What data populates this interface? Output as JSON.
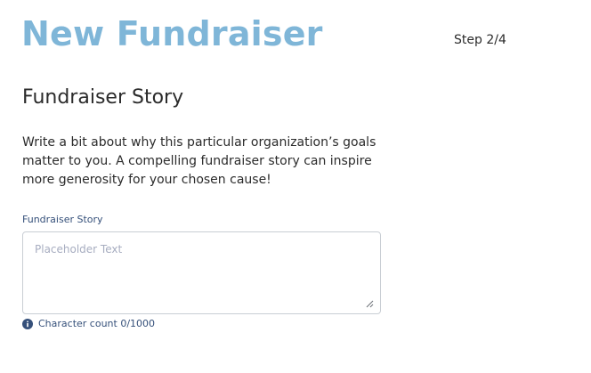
{
  "header": {
    "title": "New Fundraiser",
    "step": "Step 2/4"
  },
  "section": {
    "heading": "Fundraiser Story",
    "description": "Write a bit about why this particular organization’s goals matter to you.  A compelling fundraiser story can inspire more generosity for your chosen cause!"
  },
  "story_field": {
    "label": "Fundraiser Story",
    "placeholder": "Placeholder Text",
    "value": ""
  },
  "helper": {
    "icon": "info-icon",
    "char_count_text": "Character count 0/1000"
  },
  "colors": {
    "title": "#7fb6d8",
    "label": "#35507a",
    "text": "#2b2b2b",
    "placeholder": "#a7adc0",
    "border": "#c9ced4"
  }
}
